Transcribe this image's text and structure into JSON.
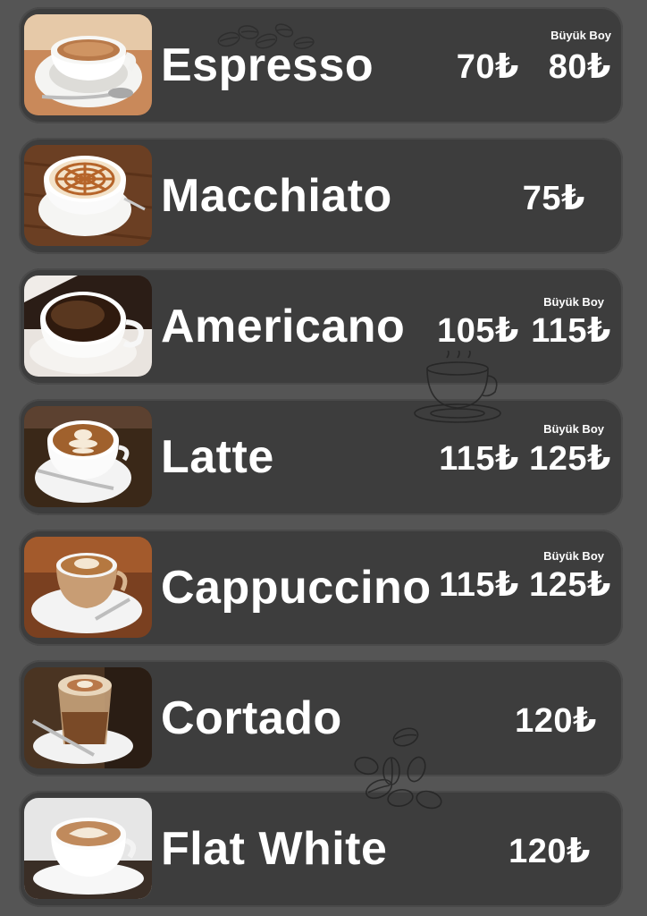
{
  "currency": "₺",
  "large_label": "Büyük Boy",
  "items": [
    {
      "name": "Espresso",
      "price": "70₺",
      "large_price": "80₺",
      "has_large": true
    },
    {
      "name": "Macchiato",
      "price": "75₺",
      "has_large": false
    },
    {
      "name": "Americano",
      "price": "105₺",
      "large_price": "115₺",
      "has_large": true
    },
    {
      "name": "Latte",
      "price": "115₺",
      "large_price": "125₺",
      "has_large": true
    },
    {
      "name": "Cappuccino",
      "price": "115₺",
      "large_price": "125₺",
      "has_large": true
    },
    {
      "name": "Cortado",
      "price": "120₺",
      "has_large": false
    },
    {
      "name": "Flat White",
      "price": "120₺",
      "has_large": false
    }
  ],
  "colors": {
    "background": "#555555",
    "card": "#3d3d3d",
    "text": "#ffffff"
  },
  "decorations": [
    "coffee-beans-sketch",
    "coffee-cup-sketch",
    "coffee-beans-sketch"
  ]
}
